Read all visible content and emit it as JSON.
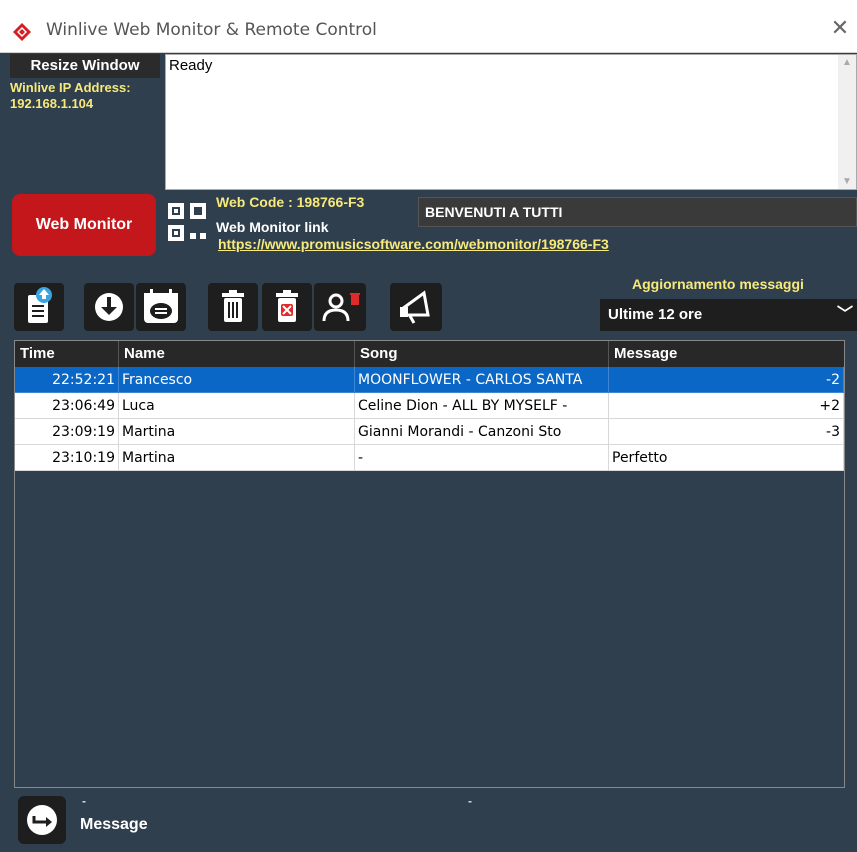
{
  "window": {
    "title": "Winlive Web Monitor & Remote Control",
    "close_glyph": "✕"
  },
  "left_panel": {
    "resize_label": "Resize Window",
    "ip_label": "Winlive IP Address:",
    "ip_value": "192.168.1.104"
  },
  "log": {
    "text": "Ready"
  },
  "web": {
    "monitor_button": "Web Monitor",
    "code": "Web Code : 198766-F3",
    "link_label": "Web Monitor link",
    "url": "https://www.promusicsoftware.com/webmonitor/198766-F3",
    "welcome_text": "BENVENUTI A TUTTI"
  },
  "toolbar": {
    "icons": [
      "upload-icon",
      "download-icon",
      "chat-list-icon",
      "trash-icon",
      "delete-red-icon",
      "remove-user-icon",
      "megaphone-icon"
    ]
  },
  "update": {
    "label": "Aggiornamento messaggi",
    "selected": "Ultime 12 ore"
  },
  "table": {
    "columns": [
      "Time",
      "Name",
      "Song",
      "Message"
    ],
    "rows": [
      {
        "time": "22:52:21",
        "name": "Francesco",
        "song": "MOONFLOWER - CARLOS SANTA",
        "message": "-2",
        "selected": true
      },
      {
        "time": "23:06:49",
        "name": "Luca",
        "song": "Celine Dion - ALL BY MYSELF -",
        "message": "+2",
        "selected": false
      },
      {
        "time": "23:09:19",
        "name": "Martina",
        "song": "Gianni Morandi - Canzoni Sto",
        "message": "-3",
        "selected": false
      },
      {
        "time": "23:10:19",
        "name": "Martina",
        "song": "-",
        "message": "Perfetto",
        "selected": false
      }
    ]
  },
  "footer": {
    "dash_left": "-",
    "dash_center": "-",
    "message_label": "Message"
  },
  "colors": {
    "panel_bg": "#2f3f4e",
    "accent_yellow": "#f7ea7a",
    "red_button": "#c4171b",
    "selected_row": "#0a67c6"
  }
}
